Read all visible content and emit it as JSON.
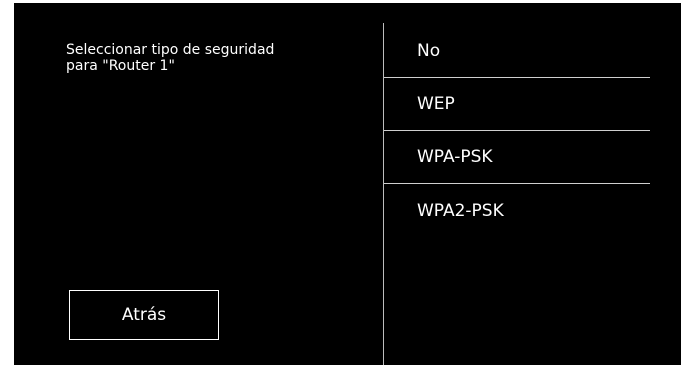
{
  "prompt": {
    "line1": "Seleccionar tipo de seguridad",
    "line2": "para \"Router 1\""
  },
  "back_button": {
    "label": "Atrás"
  },
  "security_options": [
    {
      "label": "No"
    },
    {
      "label": "WEP"
    },
    {
      "label": "WPA-PSK"
    },
    {
      "label": "WPA2-PSK"
    }
  ],
  "colors": {
    "background": "#000000",
    "text": "#ffffff",
    "divider": "#cfcfcf"
  }
}
